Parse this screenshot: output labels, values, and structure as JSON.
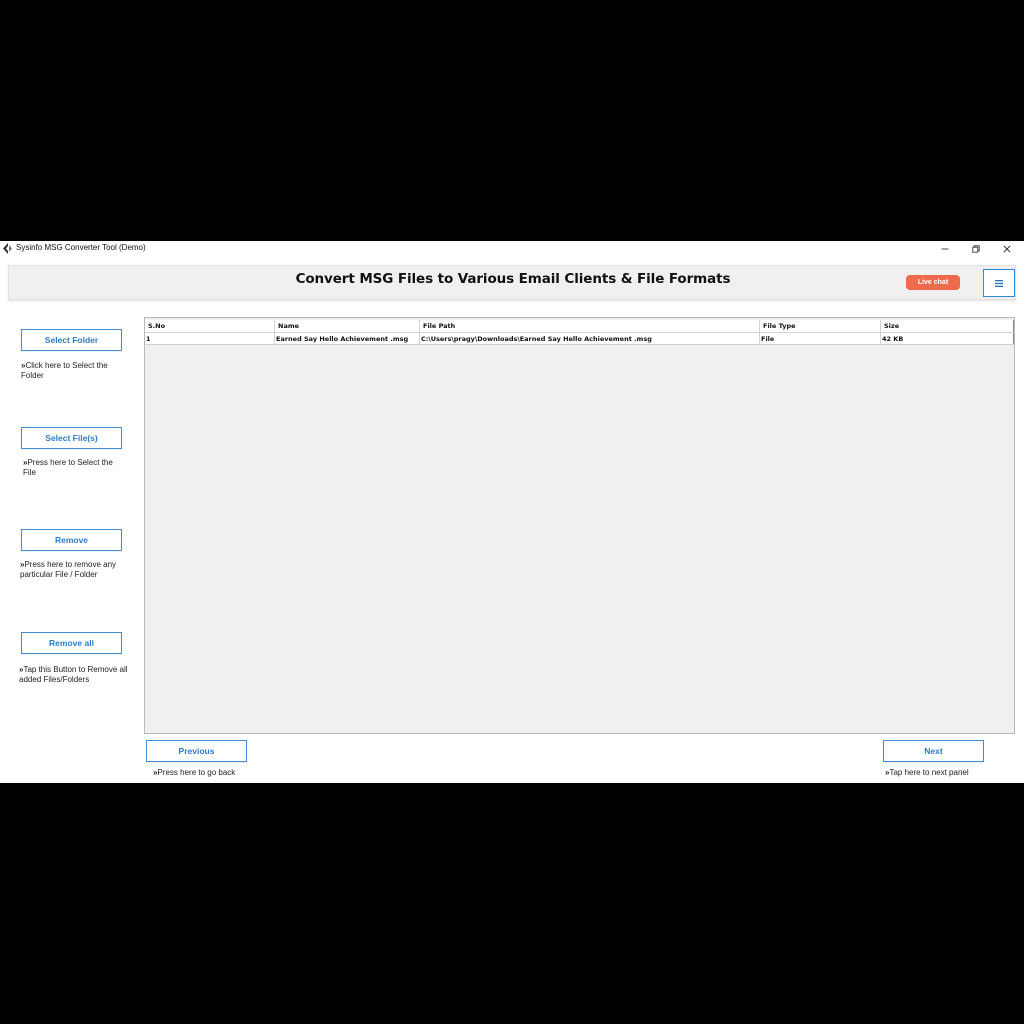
{
  "window": {
    "title": "Sysinfo MSG Converter Tool (Demo)",
    "controls": [
      "minimize-icon",
      "restore-icon",
      "close-icon"
    ]
  },
  "header": {
    "title": "Convert MSG Files to Various Email Clients & File Formats",
    "live_chat_label": "Live chat",
    "menu_icon": "hamburger-icon",
    "accent_color": "#f06a4c"
  },
  "sidebar": {
    "select_folder": {
      "label": "Select Folder",
      "hint_arrow": "»",
      "hint": "Click here to Select the Folder"
    },
    "select_files": {
      "label": "Select File(s)",
      "hint_arrow": "»",
      "hint": "Press here to Select the File"
    },
    "remove": {
      "label": "Remove",
      "hint_arrow": "»",
      "hint": "Press here to remove any particular File / Folder"
    },
    "remove_all": {
      "label": "Remove all",
      "hint_arrow": "»",
      "hint": "Tap this Button to Remove all added Files/Folders"
    },
    "button_color": "#2a7cc7"
  },
  "table": {
    "columns": [
      "S.No",
      "Name",
      "File Path",
      "File Type",
      "Size"
    ],
    "rows": [
      [
        "1",
        "Earned Say Hello Achievement .msg",
        "C:\\Users\\pragy\\Downloads\\Earned Say Hello Achievement .msg",
        "File",
        "42 KB"
      ]
    ]
  },
  "footer": {
    "previous": {
      "label": "Previous",
      "hint_arrow": "»",
      "hint": "Press here to go back"
    },
    "next": {
      "label": "Next",
      "hint_arrow": "»",
      "hint": "Tap here to next panel"
    }
  }
}
